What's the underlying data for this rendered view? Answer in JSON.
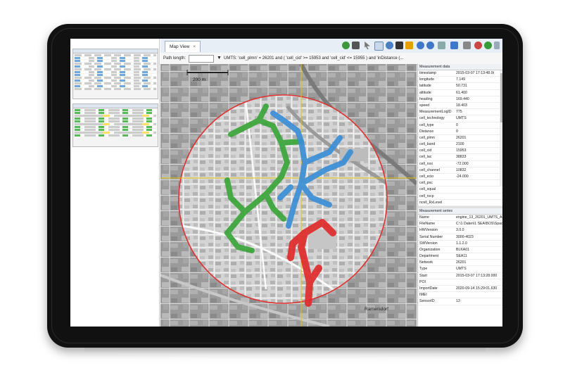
{
  "tab": {
    "label": "Map View"
  },
  "filterbar": {
    "path_length_label": "Path length:",
    "filter_text": "UMTS: 'cell_plmn' = 26201 and ( 'cell_cid' >= 15953 and 'cell_cid' <= 15955 ) and 'inDistance (..."
  },
  "map": {
    "scale_text": "200 m",
    "place_label": "Ramersdorf",
    "colors": {
      "green": "#3aa63a",
      "blue": "#3b8fd6",
      "red": "#e02b2b",
      "circle": "#e03030",
      "crosshair": "#e6c200"
    }
  },
  "measurement_data": {
    "title": "Measurement data",
    "rows": [
      {
        "k": "timestamp",
        "v": "2015-03-07 17:13:48.0t"
      },
      {
        "k": "longitude",
        "v": "7.149"
      },
      {
        "k": "latitude",
        "v": "50.731"
      },
      {
        "k": "altitude",
        "v": "61.400"
      },
      {
        "k": "heading",
        "v": "169.440"
      },
      {
        "k": "speed",
        "v": "18.403"
      },
      {
        "k": "MeasurementLogID",
        "v": "775"
      },
      {
        "k": "cell_technology",
        "v": "UMTS"
      },
      {
        "k": "cell_type",
        "v": "0"
      },
      {
        "k": "Distance",
        "v": "0"
      },
      {
        "k": "cell_plmn",
        "v": "26201"
      },
      {
        "k": "cell_band",
        "v": "2100"
      },
      {
        "k": "cell_cid",
        "v": "15953"
      },
      {
        "k": "cell_lac",
        "v": "38833"
      },
      {
        "k": "cell_rssi",
        "v": "-72.000"
      },
      {
        "k": "cell_channel",
        "v": "10832"
      },
      {
        "k": "cell_ecio",
        "v": "-24.000"
      },
      {
        "k": "cell_psc",
        "v": ""
      },
      {
        "k": "cell_squal",
        "v": ""
      },
      {
        "k": "cell_rscp",
        "v": ""
      },
      {
        "k": "ncell_RxLevel",
        "v": ""
      }
    ]
  },
  "measurement_series": {
    "title": "Measurement series",
    "rows": [
      {
        "k": "Name",
        "v": "engine_13_26201_UMTS_ANY_Alt..."
      },
      {
        "k": "FileName",
        "v": "C:\\1 Daten\\1 SEA\\BOS\\SpaceMe..."
      },
      {
        "k": "HWVersion",
        "v": "3.0.0"
      },
      {
        "k": "Serial Number",
        "v": "3000-4023"
      },
      {
        "k": "SWVersion",
        "v": "1.1.2.0"
      },
      {
        "k": "Organization",
        "v": "BLKA01"
      },
      {
        "k": "Department",
        "v": "SEA11"
      },
      {
        "k": "Network",
        "v": "26201"
      },
      {
        "k": "Type",
        "v": "UMTS"
      },
      {
        "k": "Start",
        "v": "2015-03-07 17:13:28.000"
      },
      {
        "k": "POI",
        "v": ""
      },
      {
        "k": "ImportDate",
        "v": "2020-09-14 15:29:01.630"
      },
      {
        "k": "IMEI",
        "v": ""
      },
      {
        "k": "SensorID",
        "v": "13"
      }
    ]
  }
}
